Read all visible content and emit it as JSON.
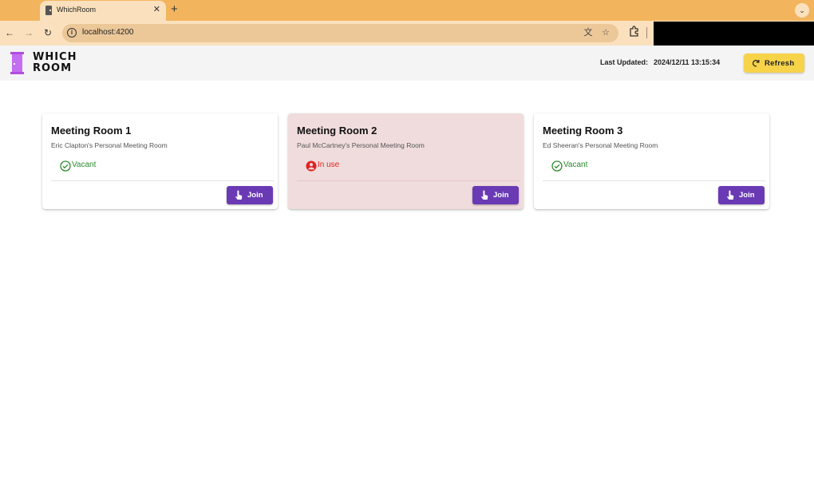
{
  "browser": {
    "tab_title": "WhichRoom",
    "url": "localhost:4200",
    "icons": [
      "back-icon",
      "forward-icon",
      "reload-icon",
      "info-icon",
      "translate-icon",
      "star-icon",
      "extensions-icon",
      "tab-close-icon",
      "new-tab-icon",
      "tab-menu-icon"
    ]
  },
  "header": {
    "logo_line1": "WHICH",
    "logo_line2": "ROOM",
    "logo_color": "#b04ee0",
    "last_updated_label": "Last Updated:",
    "last_updated_value": "2024/12/11 13:15:34",
    "refresh_label": "Refresh",
    "refresh_color": "#f7d34a"
  },
  "rooms": [
    {
      "title": "Meeting Room 1",
      "subtitle": "Eric Clapton's Personal Meeting Room",
      "status": "Vacant",
      "status_color": "#2e8b2e",
      "join_label": "Join"
    },
    {
      "title": "Meeting Room 2",
      "subtitle": "Paul McCartney's Personal Meeting Room",
      "status": "In use",
      "status_color": "#e02424",
      "join_label": "Join"
    },
    {
      "title": "Meeting Room 3",
      "subtitle": "Ed Sheeran's Personal Meeting Room",
      "status": "Vacant",
      "status_color": "#2e8b2e",
      "join_label": "Join"
    }
  ],
  "colors": {
    "accent": "#6a3ab4",
    "in_use_card": "#f0dcdc",
    "browser_frame": "#f2b55e"
  }
}
